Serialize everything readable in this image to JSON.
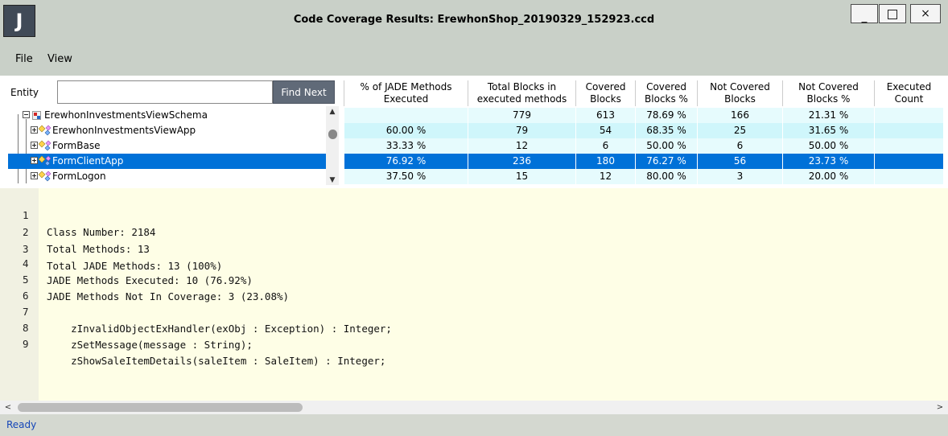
{
  "window": {
    "title": "Code Coverage Results: ErewhonShop_20190329_152923.ccd",
    "logo_letter": "J",
    "minimize_label": "_",
    "close_label": "×"
  },
  "menu": {
    "file": "File",
    "view": "View"
  },
  "entity": {
    "label": "Entity",
    "input_value": "",
    "find_next_label": "Find Next"
  },
  "columns": [
    "% of JADE Methods Executed",
    "Total Blocks in executed methods",
    "Covered Blocks",
    "Covered Blocks %",
    "Not Covered Blocks",
    "Not Covered Blocks %",
    "Executed Count"
  ],
  "tree": [
    {
      "label": "ErewhonInvestmentsViewSchema",
      "icon": "schema-icon",
      "selected": false
    },
    {
      "label": "ErewhonInvestmentsViewApp",
      "icon": "class-icon",
      "selected": false
    },
    {
      "label": "FormBase",
      "icon": "class-icon",
      "selected": false
    },
    {
      "label": "FormClientApp",
      "icon": "class-icon",
      "selected": true
    },
    {
      "label": "FormLogon",
      "icon": "class-icon",
      "selected": false
    }
  ],
  "rows": [
    {
      "pct_executed": "",
      "total_blocks": "779",
      "covered": "613",
      "covered_pct": "78.69 %",
      "not_covered": "166",
      "not_covered_pct": "21.31 %",
      "executed_count": ""
    },
    {
      "pct_executed": "60.00 %",
      "total_blocks": "79",
      "covered": "54",
      "covered_pct": "68.35 %",
      "not_covered": "25",
      "not_covered_pct": "31.65 %",
      "executed_count": ""
    },
    {
      "pct_executed": "33.33 %",
      "total_blocks": "12",
      "covered": "6",
      "covered_pct": "50.00 %",
      "not_covered": "6",
      "not_covered_pct": "50.00 %",
      "executed_count": ""
    },
    {
      "pct_executed": "76.92 %",
      "total_blocks": "236",
      "covered": "180",
      "covered_pct": "76.27 %",
      "not_covered": "56",
      "not_covered_pct": "23.73 %",
      "executed_count": ""
    },
    {
      "pct_executed": "37.50 %",
      "total_blocks": "15",
      "covered": "12",
      "covered_pct": "80.00 %",
      "not_covered": "3",
      "not_covered_pct": "20.00 %",
      "executed_count": ""
    }
  ],
  "code": {
    "line_numbers": [
      "1",
      "2",
      "3",
      "4",
      "5",
      "6",
      "7",
      "8",
      "9"
    ],
    "lines": [
      "Class Number: 2184",
      "Total Methods: 13",
      "Total JADE Methods: 13 (100%)",
      "JADE Methods Executed: 10 (76.92%)",
      "JADE Methods Not In Coverage: 3 (23.08%)",
      "",
      "    zInvalidObjectExHandler(exObj : Exception) : Integer;",
      "    zSetMessage(message : String);",
      "    zShowSaleItemDetails(saleItem : SaleItem) : Integer;"
    ]
  },
  "status": {
    "text": "Ready"
  },
  "colors": {
    "selection": "#0071d8",
    "row_band_a": "#e6fbfd",
    "row_band_b": "#cff6fb",
    "code_background": "#fefee6",
    "status_text": "#1546b8"
  }
}
